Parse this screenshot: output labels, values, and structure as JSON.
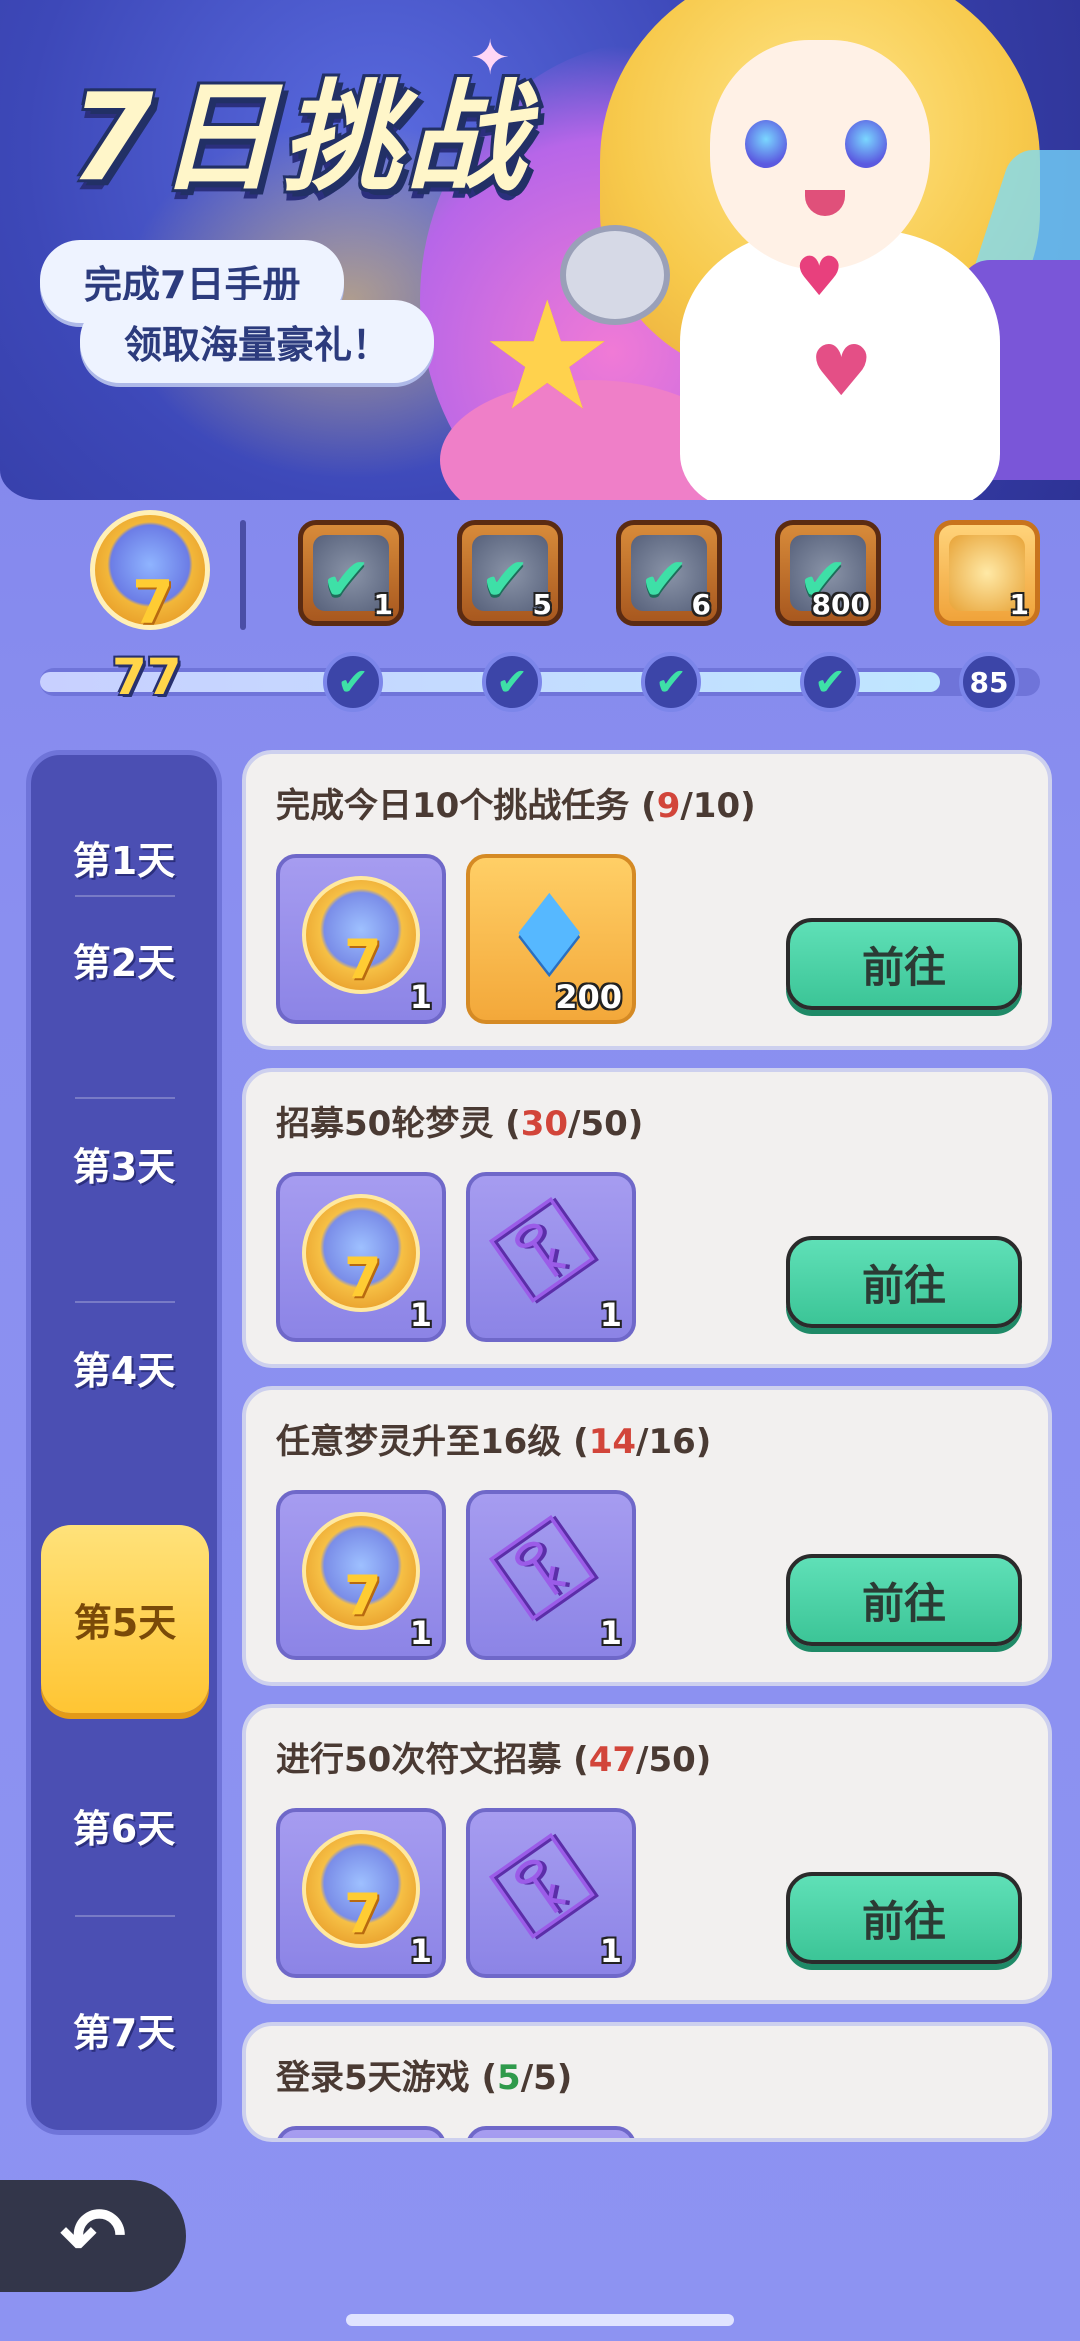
{
  "banner": {
    "title": "7日挑战",
    "subtitle_line1": "完成7日手册",
    "subtitle_line2": "领取海量豪礼！"
  },
  "progress": {
    "score": "77",
    "milestones": [
      {
        "reward_icon": "hammer-icon",
        "count": "1",
        "claimed": true
      },
      {
        "reward_icon": "key-icon",
        "count": "5",
        "claimed": true
      },
      {
        "reward_icon": "chest-icon",
        "count": "6",
        "claimed": true
      },
      {
        "reward_icon": "diamond-icon",
        "count": "800",
        "claimed": true
      },
      {
        "reward_icon": "gold-chest-icon",
        "count": "1",
        "claimed": false,
        "threshold": "85"
      }
    ]
  },
  "days": [
    {
      "label": "第1天"
    },
    {
      "label": "第2天"
    },
    {
      "label": "第3天"
    },
    {
      "label": "第4天"
    },
    {
      "label": "第5天",
      "active": true
    },
    {
      "label": "第6天"
    },
    {
      "label": "第7天"
    }
  ],
  "tasks": [
    {
      "title_prefix": "完成今日10个挑战任务 (",
      "current": "9",
      "total": "/10)",
      "rewards": [
        {
          "icon": "medal-icon",
          "qty": "1"
        },
        {
          "icon": "diamond-icon",
          "qty": "200"
        }
      ],
      "button": "前往"
    },
    {
      "title_prefix": "招募50轮梦灵 (",
      "current": "30",
      "total": "/50)",
      "rewards": [
        {
          "icon": "medal-icon",
          "qty": "1"
        },
        {
          "icon": "purple-key-icon",
          "qty": "1"
        }
      ],
      "button": "前往"
    },
    {
      "title_prefix": "任意梦灵升至16级 (",
      "current": "14",
      "total": "/16)",
      "rewards": [
        {
          "icon": "medal-icon",
          "qty": "1"
        },
        {
          "icon": "purple-key-icon",
          "qty": "1"
        }
      ],
      "button": "前往"
    },
    {
      "title_prefix": "进行50次符文招募 (",
      "current": "47",
      "total": "/50)",
      "rewards": [
        {
          "icon": "medal-icon",
          "qty": "1"
        },
        {
          "icon": "purple-key-icon",
          "qty": "1"
        }
      ],
      "button": "前往"
    },
    {
      "title_prefix": "登录5天游戏 (",
      "current": "5",
      "total": "/5)"
    }
  ],
  "colors": {
    "accent_green": "#3cc597",
    "progress_red": "#d2453a",
    "progress_green": "#2f9a4b",
    "active_tab": "#ffc533"
  }
}
